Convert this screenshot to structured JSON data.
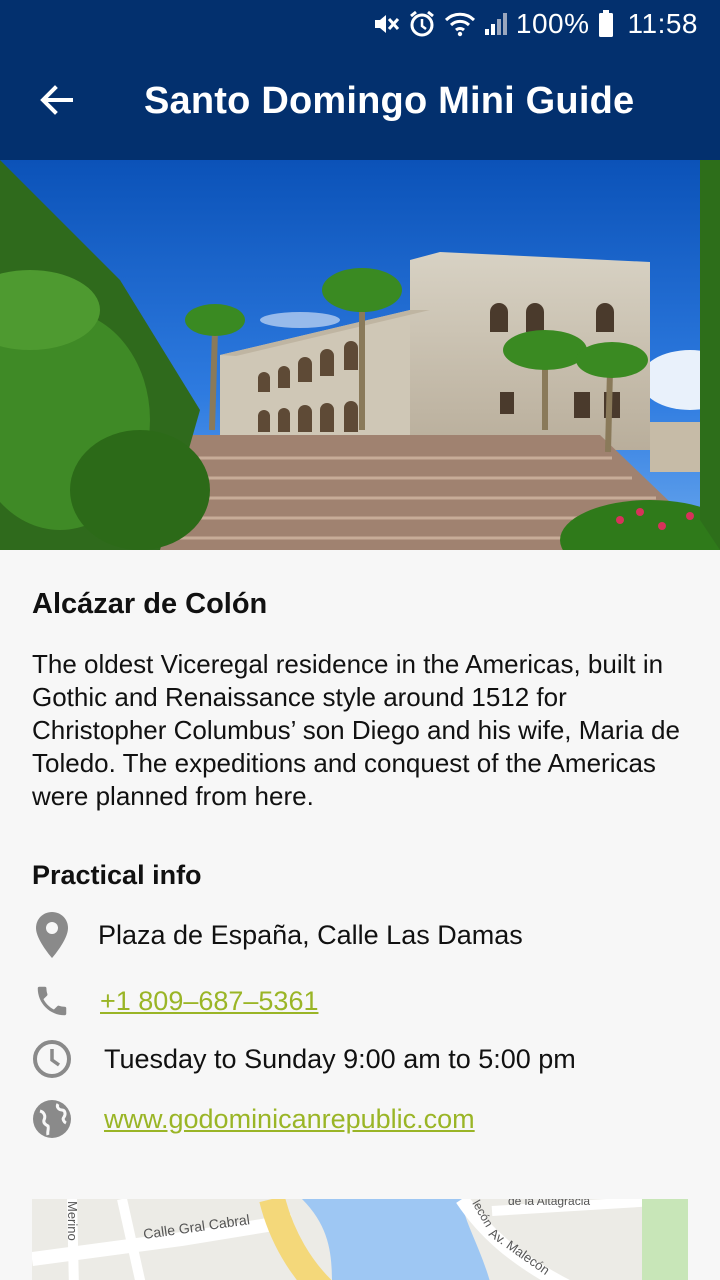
{
  "status_bar": {
    "battery": "100%",
    "time": "11:58",
    "icons": [
      "mute-icon",
      "alarm-icon",
      "wifi-icon",
      "signal-icon",
      "battery-icon"
    ]
  },
  "header": {
    "title": "Santo Domingo Mini Guide",
    "back_icon": "arrow-back-icon",
    "background_color": "#03306e"
  },
  "place": {
    "name": "Alcázar de Colón",
    "description": "The oldest Viceregal residence in the Americas, built in Gothic and Renaissance style around 1512 for Christopher Columbus’ son Diego and his wife, Maria de Toledo. The expeditions and conquest of the Americas were planned from here."
  },
  "practical_info": {
    "title": "Practical info",
    "address": "Plaza de España, Calle Las Damas",
    "phone": "+1 809–687–5361",
    "hours": "Tuesday to Sunday 9:00 am to 5:00 pm",
    "website": "www.godominicanrepublic.com",
    "link_color": "#9ab526",
    "icon_color": "#8a8a8a"
  },
  "map": {
    "labels": [
      "Calle Gral Cabral",
      "Av. Malecón",
      "de la Altagracia",
      "Merino",
      "lecón"
    ]
  }
}
